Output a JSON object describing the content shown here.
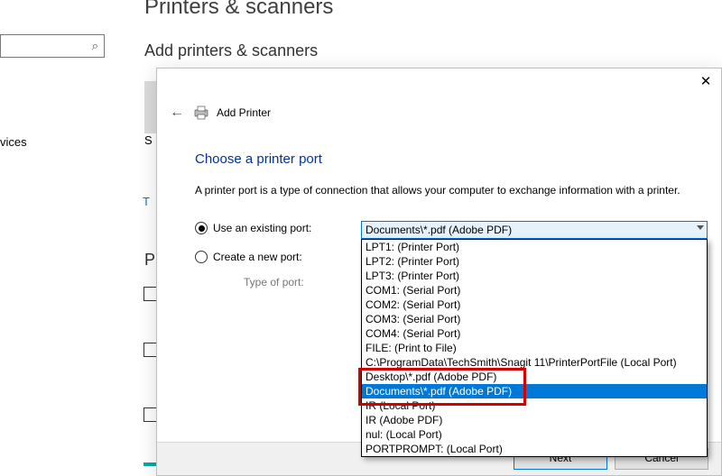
{
  "settings": {
    "page_title": "Printers & scanners",
    "subheader": "Add printers & scanners",
    "side_link_truncated": "vices",
    "letter_p": "P",
    "letter_s": "S",
    "letter_t": "T"
  },
  "wizard": {
    "title": "Add Printer",
    "heading": "Choose a printer port",
    "description": "A printer port is a type of connection that allows your computer to exchange information with a printer.",
    "radio_existing_label": "Use an existing port:",
    "radio_new_label": "Create a new port:",
    "type_label": "Type of port:",
    "combo_selected": "Documents\\*.pdf (Adobe PDF)",
    "ports": [
      "LPT1: (Printer Port)",
      "LPT2: (Printer Port)",
      "LPT3: (Printer Port)",
      "COM1: (Serial Port)",
      "COM2: (Serial Port)",
      "COM3: (Serial Port)",
      "COM4: (Serial Port)",
      "FILE: (Print to File)",
      "C:\\ProgramData\\TechSmith\\Snagit 11\\PrinterPortFile (Local Port)",
      "Desktop\\*.pdf (Adobe PDF)",
      "Documents\\*.pdf (Adobe PDF)",
      "IR (Local Port)",
      "IR (Adobe PDF)",
      "nul: (Local Port)",
      "PORTPROMPT: (Local Port)"
    ],
    "selected_port_index": 10,
    "buttons": {
      "next": "Next",
      "cancel": "Cancel"
    }
  }
}
